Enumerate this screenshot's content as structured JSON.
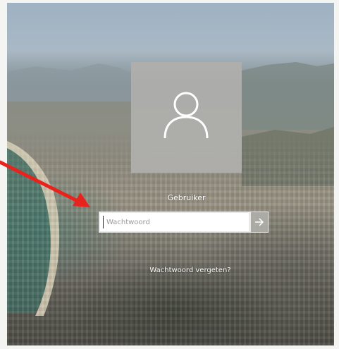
{
  "login": {
    "username": "Gebruiker",
    "password_placeholder": "Wachtwoord",
    "password_value": "",
    "forgot_password": "Wachtwoord vergeten?"
  },
  "icons": {
    "avatar": "user-icon",
    "submit": "arrow-right-icon"
  },
  "colors": {
    "tile": "#b0b0ac",
    "text": "#ffffff",
    "annotation_arrow": "#e8221c"
  }
}
